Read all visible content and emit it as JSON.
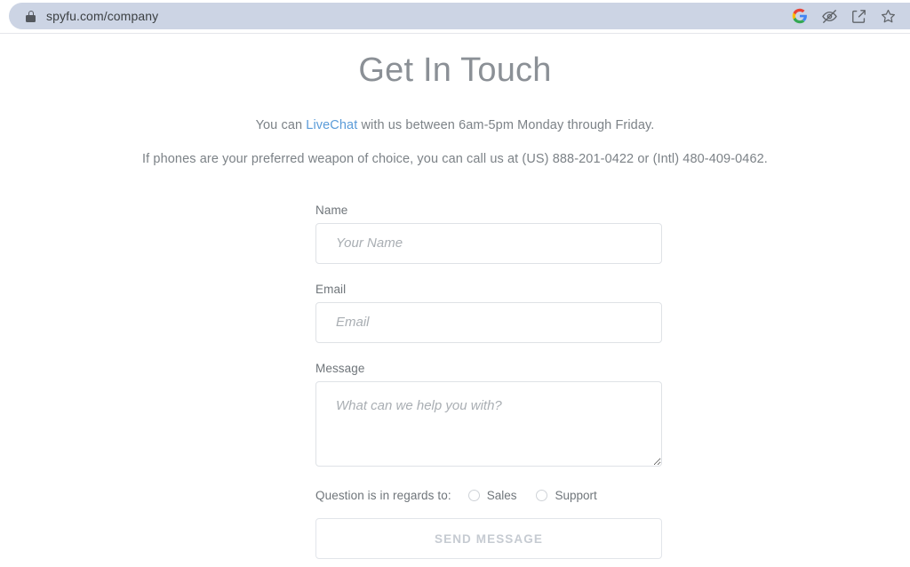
{
  "browser": {
    "url": "spyfu.com/company",
    "lock_icon": "lock-icon",
    "actions": [
      {
        "name": "google-account-icon",
        "label": "G"
      },
      {
        "name": "eye-slash-icon",
        "label": ""
      },
      {
        "name": "share-icon",
        "label": ""
      },
      {
        "name": "bookmark-star-icon",
        "label": ""
      }
    ]
  },
  "page": {
    "title": "Get In Touch",
    "intro": {
      "line1_before": "You can ",
      "line1_link": "LiveChat",
      "line1_after": " with us between 6am-5pm Monday through Friday.",
      "line2": "If phones are your preferred weapon of choice, you can call us at (US) 888-201-0422 or (Intl) 480-409-0462."
    },
    "form": {
      "name_label": "Name",
      "name_placeholder": "Your Name",
      "name_value": "",
      "email_label": "Email",
      "email_placeholder": "Email",
      "email_value": "",
      "message_label": "Message",
      "message_placeholder": "What can we help you with?",
      "message_value": "",
      "regards_label": "Question is in regards to:",
      "radio_sales": "Sales",
      "radio_support": "Support",
      "submit_label": "SEND MESSAGE"
    }
  },
  "colors": {
    "link": "#5a9bd8",
    "omnibox_bg": "#ccd4e4",
    "title_text": "#8b9096",
    "body_text": "#7c8287",
    "input_border": "#dfe2e6",
    "submit_text": "#c6cbd2"
  }
}
